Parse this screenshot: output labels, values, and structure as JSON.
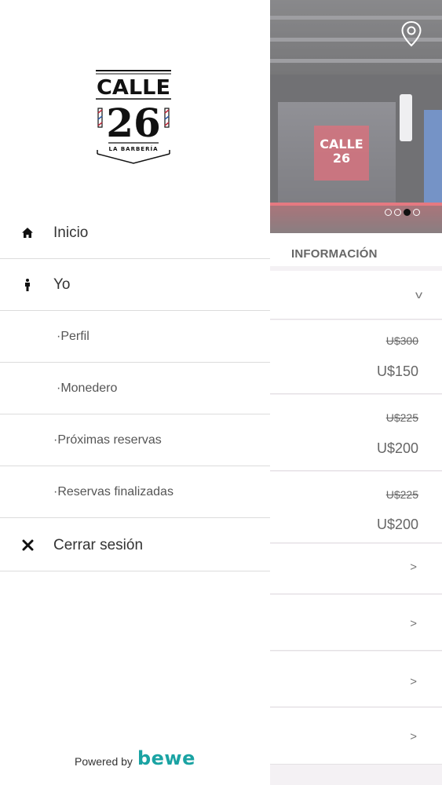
{
  "colors": {
    "drawer_bg": "#ffffff",
    "divider": "#dcdcdc",
    "text_primary": "#333333",
    "text_secondary": "#555555",
    "brand_teal": "#1aa3a3",
    "background_panel": "#f4f1f4"
  },
  "logo": {
    "name": "CALLE",
    "number": "26",
    "tagline": "LA BARBERÍA"
  },
  "menu": {
    "items": [
      {
        "label": "Inicio",
        "icon": "home-icon"
      },
      {
        "label": "Yo",
        "icon": "person-icon"
      },
      {
        "label": "·Perfil"
      },
      {
        "label": "·Monedero"
      },
      {
        "label": "·Próximas reservas"
      },
      {
        "label": "·Reservas finalizadas"
      },
      {
        "label": "Cerrar sesión",
        "icon": "close-icon"
      }
    ]
  },
  "footer": {
    "powered_text": "Powered by",
    "brand": "bewe"
  },
  "background": {
    "hero": {
      "icon": "location-pin-icon",
      "slides": 4,
      "active_slide": 3
    },
    "info_title": "INFORMACIÓN",
    "expand_icon": "chevron-down-icon",
    "services": [
      {
        "old_price": "U$300",
        "price": "U$150"
      },
      {
        "old_price": "U$225",
        "price": "U$200"
      },
      {
        "old_price": "U$225",
        "price": "U$200"
      }
    ],
    "links": [
      {
        "icon": "chevron-right-icon",
        "glyph": ">"
      },
      {
        "icon": "chevron-right-icon",
        "glyph": ">"
      },
      {
        "icon": "chevron-right-icon",
        "glyph": ">"
      },
      {
        "icon": "chevron-right-icon",
        "glyph": ">"
      }
    ]
  }
}
